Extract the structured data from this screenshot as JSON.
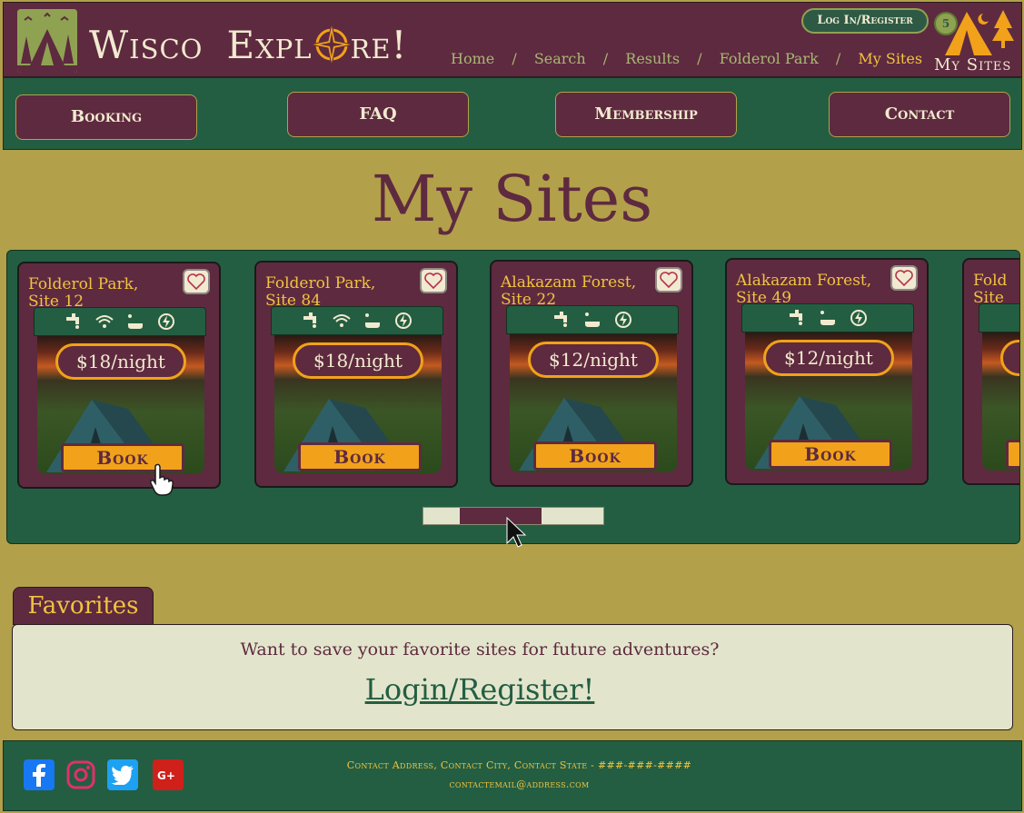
{
  "header": {
    "brand_word1": "Wisco",
    "brand_word2_pre": "Expl",
    "brand_word2_post": "re!",
    "breadcrumbs": [
      "Home",
      "Search",
      "Results",
      "Folderol Park",
      "My Sites"
    ],
    "breadcrumb_separator": "/",
    "login_label": "Log In/Register",
    "mysites_count": "5",
    "mysites_label": "My Sites"
  },
  "nav": {
    "items": [
      "Booking",
      "FAQ",
      "Membership",
      "Contact"
    ]
  },
  "page_title": "My Sites",
  "sites": [
    {
      "name": "Folderol Park,",
      "site": "Site 12",
      "price": "$18/night",
      "amenities": [
        "water-icon",
        "wifi-icon",
        "shower-icon",
        "electric-icon"
      ],
      "book_label": "Book"
    },
    {
      "name": "Folderol Park,",
      "site": "Site 84",
      "price": "$18/night",
      "amenities": [
        "water-icon",
        "wifi-icon",
        "shower-icon",
        "electric-icon"
      ],
      "book_label": "Book"
    },
    {
      "name": "Alakazam Forest,",
      "site": "Site 22",
      "price": "$12/night",
      "amenities": [
        "water-icon",
        "shower-icon",
        "electric-icon"
      ],
      "book_label": "Book"
    },
    {
      "name": "Alakazam Forest,",
      "site": "Site 49",
      "price": "$12/night",
      "amenities": [
        "water-icon",
        "shower-icon",
        "electric-icon"
      ],
      "book_label": "Book"
    },
    {
      "name": "Fold",
      "site": "Site",
      "price": "",
      "amenities": [],
      "book_label": ""
    }
  ],
  "favorites": {
    "tab_label": "Favorites",
    "prompt": "Want to save your favorite sites for future adventures?",
    "login_link": "Login/Register!"
  },
  "footer": {
    "address": "Contact Address, Contact City, Contact State - ###-###-####",
    "email": "contactemail@address.com",
    "social": [
      "facebook-icon",
      "instagram-icon",
      "twitter-icon",
      "google-plus-icon"
    ]
  },
  "colors": {
    "maroon": "#5e2a3f",
    "forest": "#235e42",
    "mustard": "#b2a04b",
    "gold": "#f1c341",
    "orange": "#f1a21a",
    "cream": "#e2e5cc"
  }
}
